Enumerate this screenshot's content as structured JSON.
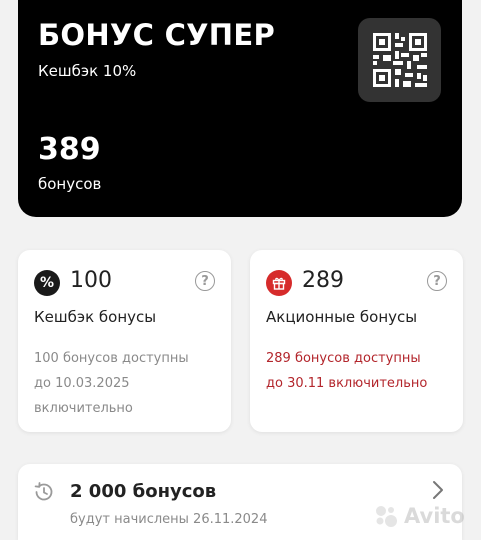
{
  "card": {
    "title": "БОНУС СУПЕР",
    "cashback_rate": "Кешбэк 10%",
    "total": "389",
    "unit": "бонусов",
    "qr_icon": "qr-code-icon"
  },
  "tiles": [
    {
      "icon": "percent-icon",
      "icon_glyph": "%",
      "icon_color": "#1a1a1a",
      "amount": "100",
      "label": "Кешбэк бонусы",
      "note_lines": [
        "100 бонусов доступны",
        "до 10.03.2025",
        "включительно"
      ],
      "note_color": "#8a8a8a"
    },
    {
      "icon": "gift-icon",
      "icon_color": "#d62b2b",
      "amount": "289",
      "label": "Акционные бонусы",
      "note_lines": [
        "289 бонусов доступны",
        "до 30.11 включительно"
      ],
      "note_color": "#b3262c"
    }
  ],
  "help_glyph": "?",
  "accrual": {
    "amount": "2 000 бонусов",
    "date": "будут начислены 26.11.2024",
    "icon": "clock-history-icon"
  },
  "watermark": {
    "text": "Avito",
    "icon": "avito-logo"
  }
}
